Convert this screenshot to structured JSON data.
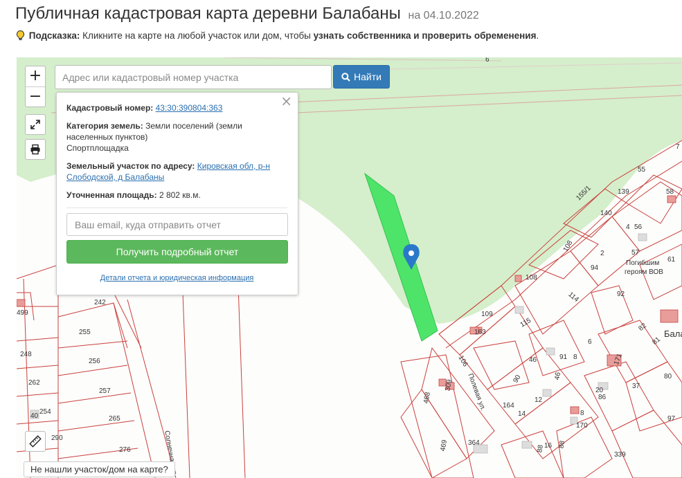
{
  "header": {
    "title": "Публичная кадастровая карта деревни Балабаны",
    "date": "на 04.10.2022"
  },
  "hint": {
    "label": "Подсказка:",
    "text": "Кликните на карте на любой участок или дом, чтобы",
    "bold_text": "узнать собственника и проверить обременения",
    "end": "."
  },
  "map": {
    "zoom_in": "+",
    "zoom_out": "−",
    "search_placeholder": "Адрес или кадастровый номер участка",
    "find_label": "Найти",
    "not_found": "Не нашли участок/дом на карте?",
    "labels": {
      "memorial": "Погибшим",
      "memorial2": "героям ВОВ",
      "village_partial": "Бала",
      "street1": "Полевая ул.",
      "street2": "Солнечная ул."
    },
    "parcel_numbers": [
      "499",
      "242",
      "255",
      "248",
      "256",
      "262",
      "257",
      "40",
      "254",
      "265",
      "290",
      "276",
      "468",
      "309",
      "469",
      "364",
      "339",
      "106",
      "163",
      "109",
      "115",
      "90",
      "164",
      "14",
      "12",
      "46",
      "91",
      "8",
      "46",
      "170",
      "8",
      "88",
      "16",
      "88",
      "20",
      "86",
      "37",
      "80",
      "97",
      "82",
      "81",
      "171",
      "55",
      "139",
      "58",
      "140",
      "4",
      "56",
      "57",
      "61",
      "94",
      "2",
      "92",
      "114",
      "108",
      "108",
      "6",
      "155/1",
      "6",
      "7"
    ]
  },
  "popup": {
    "cadastral_label": "Кадастровый номер:",
    "cadastral_value": "43:30:390804:363",
    "category_label": "Категория земель:",
    "category_value": "Земли поселений (земли населенных пунктов)",
    "category_use": "Спортплощадка",
    "address_label": "Земельный участок по адресу:",
    "address_value": "Кировская обл, р-н Слободской, д Балабаны",
    "area_label": "Уточненная площадь:",
    "area_value": "2 802 кв.м.",
    "email_placeholder": "Ваш email, куда отправить отчет",
    "report_button": "Получить подробный отчет",
    "details_link": "Детали отчета и юридическая информация",
    "close": "×"
  },
  "colors": {
    "accent_blue": "#337ab7",
    "green_button": "#5cb85c",
    "forest": "#d5eecb",
    "selected_parcel": "#4ee46a",
    "parcel_line": "#c9403b",
    "marker": "#2a79c9"
  }
}
